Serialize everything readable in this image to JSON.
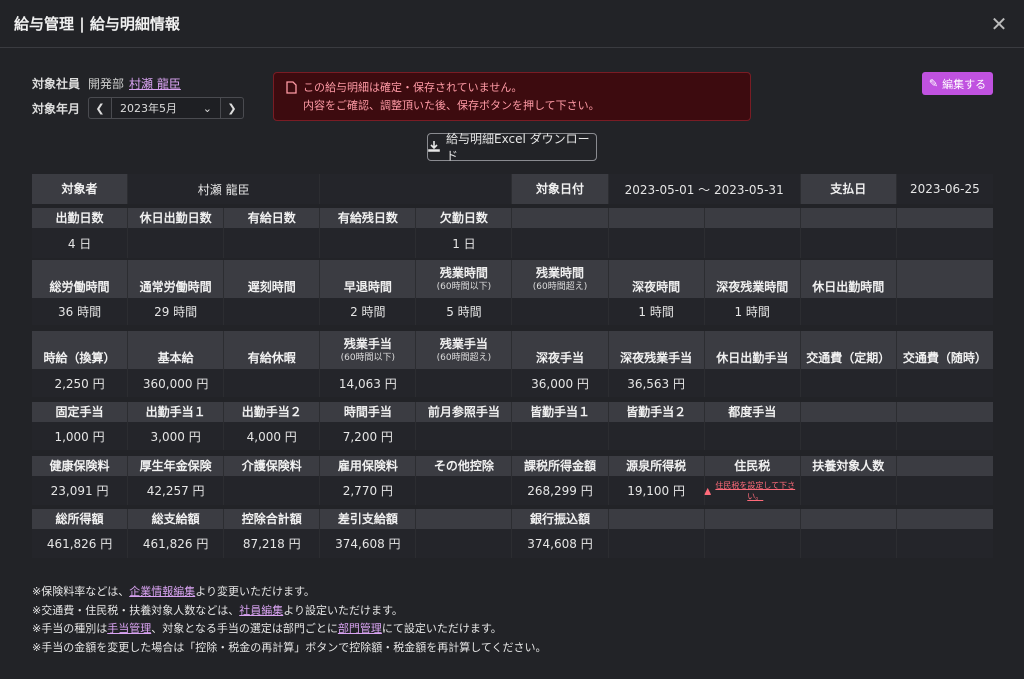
{
  "window": {
    "title": "給与管理 | 給与明細情報"
  },
  "meta": {
    "employee_label": "対象社員",
    "department": "開発部",
    "employee_name": "村瀬 龍臣",
    "month_label": "対象年月",
    "month_value": "2023年5月"
  },
  "alert": {
    "line1": "この給与明細は確定・保存されていません。",
    "line2": "内容をご確認、調整頂いた後、保存ボタンを押して下さい。"
  },
  "buttons": {
    "edit": "編集する",
    "download": "給与明細Excel ダウンロード"
  },
  "summary": {
    "target_label": "対象者",
    "target_value": "村瀬 龍臣",
    "period_label": "対象日付",
    "period_value": "2023-05-01 〜 2023-05-31",
    "pay_label": "支払日",
    "pay_value": "2023-06-25"
  },
  "sections": [
    {
      "headers": [
        [
          "出勤日数",
          ""
        ],
        [
          "休日出勤日数",
          ""
        ],
        [
          "有給日数",
          ""
        ],
        [
          "有給残日数",
          ""
        ],
        [
          "欠勤日数",
          ""
        ],
        [
          "",
          ""
        ],
        [
          "",
          ""
        ],
        [
          "",
          ""
        ],
        [
          "",
          ""
        ],
        [
          "",
          ""
        ]
      ],
      "values": [
        "4 日",
        "",
        "",
        "",
        "1 日",
        "",
        "",
        "",
        "",
        ""
      ]
    },
    {
      "headers": [
        [
          "総労働時間",
          ""
        ],
        [
          "通常労働時間",
          ""
        ],
        [
          "遅刻時間",
          ""
        ],
        [
          "早退時間",
          ""
        ],
        [
          "残業時間",
          "(60時間以下)"
        ],
        [
          "残業時間",
          "(60時間超え)"
        ],
        [
          "深夜時間",
          ""
        ],
        [
          "深夜残業時間",
          ""
        ],
        [
          "休日出勤時間",
          ""
        ],
        [
          "",
          ""
        ]
      ],
      "values": [
        "36 時間",
        "29 時間",
        "",
        "2 時間",
        "5 時間",
        "",
        "1 時間",
        "1 時間",
        "",
        ""
      ]
    },
    {
      "headers": [
        [
          "時給（換算）",
          ""
        ],
        [
          "基本給",
          ""
        ],
        [
          "有給休暇",
          ""
        ],
        [
          "残業手当",
          "(60時間以下)"
        ],
        [
          "残業手当",
          "(60時間超え)"
        ],
        [
          "深夜手当",
          ""
        ],
        [
          "深夜残業手当",
          ""
        ],
        [
          "休日出勤手当",
          ""
        ],
        [
          "交通費（定期）",
          ""
        ],
        [
          "交通費（随時）",
          ""
        ]
      ],
      "values": [
        "2,250 円",
        "360,000 円",
        "",
        "14,063 円",
        "",
        "36,000 円",
        "36,563 円",
        "",
        "",
        ""
      ]
    },
    {
      "headers": [
        [
          "固定手当",
          ""
        ],
        [
          "出勤手当１",
          ""
        ],
        [
          "出勤手当２",
          ""
        ],
        [
          "時間手当",
          ""
        ],
        [
          "前月参照手当",
          ""
        ],
        [
          "皆勤手当１",
          ""
        ],
        [
          "皆勤手当２",
          ""
        ],
        [
          "都度手当",
          ""
        ],
        [
          "",
          ""
        ],
        [
          "",
          ""
        ]
      ],
      "values": [
        "1,000 円",
        "3,000 円",
        "4,000 円",
        "7,200 円",
        "",
        "",
        "",
        "",
        "",
        ""
      ]
    },
    {
      "headers": [
        [
          "健康保険料",
          ""
        ],
        [
          "厚生年金保険",
          ""
        ],
        [
          "介護保険料",
          ""
        ],
        [
          "雇用保険料",
          ""
        ],
        [
          "その他控除",
          ""
        ],
        [
          "課税所得金額",
          ""
        ],
        [
          "源泉所得税",
          ""
        ],
        [
          "住民税",
          ""
        ],
        [
          "扶養対象人数",
          ""
        ],
        [
          "",
          ""
        ]
      ],
      "values": [
        "23,091 円",
        "42,257 円",
        "",
        "2,770 円",
        "",
        "268,299 円",
        "19,100 円",
        "",
        "",
        ""
      ],
      "warning_text": "住民税を設定して下さい。"
    },
    {
      "headers": [
        [
          "総所得額",
          ""
        ],
        [
          "総支給額",
          ""
        ],
        [
          "控除合計額",
          ""
        ],
        [
          "差引支給額",
          ""
        ],
        [
          "",
          ""
        ],
        [
          "銀行振込額",
          ""
        ],
        [
          "",
          ""
        ],
        [
          "",
          ""
        ],
        [
          "",
          ""
        ],
        [
          "",
          ""
        ]
      ],
      "values": [
        "461,826 円",
        "461,826 円",
        "87,218 円",
        "374,608 円",
        "",
        "374,608 円",
        "",
        "",
        "",
        ""
      ]
    }
  ],
  "notes": [
    {
      "pre": "※保険料率などは、",
      "link": "企業情報編集",
      "post": "より変更いただけます。"
    },
    {
      "pre": "※交通費・住民税・扶養対象人数などは、",
      "link": "社員編集",
      "post": "より設定いただけます。"
    },
    {
      "pre": "※手当の種別は",
      "link": "手当管理",
      "post": "、対象となる手当の選定は部門ごとに",
      "link2": "部門管理",
      "post2": "にて設定いただけます。"
    },
    {
      "pre": "※手当の金額を変更した場合は「控除・税金の再計算」ボタンで控除額・税金額を再計算してください。",
      "link": "",
      "post": ""
    }
  ]
}
